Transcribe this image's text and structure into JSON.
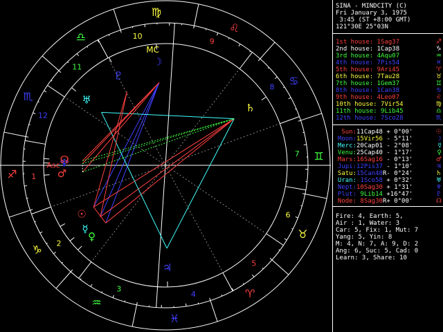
{
  "header": {
    "title": "SINA - MINDCITY (C)",
    "date": "Fri January 3, 1975",
    "time": " 3:45 (ST +8:00 GMT)",
    "location": "121°30E 25°03N"
  },
  "houses": [
    {
      "label": "1st house:",
      "value": " 1Sag37",
      "glyph": "♐",
      "color": "#ff4040"
    },
    {
      "label": "2nd house:",
      "value": " 1Cap38",
      "glyph": "♑",
      "color": "#ffffff"
    },
    {
      "label": "3rd house:",
      "value": " 4Aqu07",
      "glyph": "♒",
      "color": "#40ff40"
    },
    {
      "label": "4th house:",
      "value": " 7Pis54",
      "glyph": "♓",
      "color": "#4040ff"
    },
    {
      "label": "5th house:",
      "value": " 9Ari45",
      "glyph": "♈",
      "color": "#ff4040"
    },
    {
      "label": "6th house:",
      "value": " 7Tau28",
      "glyph": "♉",
      "color": "#ffff40"
    },
    {
      "label": "7th house:",
      "value": " 1Gem37",
      "glyph": "♊",
      "color": "#40ff40"
    },
    {
      "label": "8th house:",
      "value": " 1Can38",
      "glyph": "♋",
      "color": "#4040ff"
    },
    {
      "label": "9th house:",
      "value": " 4Leo07",
      "glyph": "♌",
      "color": "#ff4040"
    },
    {
      "label": "10th house:",
      "value": " 7Vir54",
      "glyph": "♍",
      "color": "#ffff40"
    },
    {
      "label": "11th house:",
      "value": " 9Lib45",
      "glyph": "♎",
      "color": "#40ff40"
    },
    {
      "label": "12th house:",
      "value": " 7Sco28",
      "glyph": "♏",
      "color": "#4040ff"
    }
  ],
  "planets": [
    {
      "name": "Sun:",
      "pos": "11Cap48",
      "r": " ",
      "lat": "+ 0°00'",
      "glyph": "☉",
      "color": "#ff4040",
      "poscolor": "#ffffff"
    },
    {
      "name": "Moon:",
      "pos": "15Vir56",
      "r": " ",
      "lat": "- 5°11'",
      "glyph": "☽",
      "color": "#4040ff",
      "poscolor": "#ffff40"
    },
    {
      "name": "Merc:",
      "pos": "20Cap01",
      "r": " ",
      "lat": "- 2°08'",
      "glyph": "☿",
      "color": "#40ffff",
      "poscolor": "#ffffff"
    },
    {
      "name": "Venu:",
      "pos": "25Cap40",
      "r": " ",
      "lat": "- 1°17'",
      "glyph": "♀",
      "color": "#40ff40",
      "poscolor": "#ffffff"
    },
    {
      "name": "Mars:",
      "pos": "16Sag16",
      "r": " ",
      "lat": "- 0°13'",
      "glyph": "♂",
      "color": "#ff4040",
      "poscolor": "#ff4040"
    },
    {
      "name": "Jupi:",
      "pos": "12Pis37",
      "r": " ",
      "lat": "- 1°10'",
      "glyph": "♃",
      "color": "#4040ff",
      "poscolor": "#4040ff"
    },
    {
      "name": "Satu:",
      "pos": "15Can48",
      "r": "R",
      "lat": "- 0°24'",
      "glyph": "♄",
      "color": "#ffff40",
      "poscolor": "#4040ff"
    },
    {
      "name": "Uran:",
      "pos": " 1Sco58",
      "r": " ",
      "lat": "+ 0°32'",
      "glyph": "♅",
      "color": "#40ffff",
      "poscolor": "#4040ff"
    },
    {
      "name": "Nept:",
      "pos": "10Sag30",
      "r": " ",
      "lat": "+ 1°31'",
      "glyph": "♆",
      "color": "#4040ff",
      "poscolor": "#ff4040"
    },
    {
      "name": "Plut:",
      "pos": " 9Lib14",
      "r": " ",
      "lat": "+16°47'",
      "glyph": "♇",
      "color": "#4040ff",
      "poscolor": "#40ff40"
    },
    {
      "name": "Node:",
      "pos": " 8Sag30",
      "r": "R",
      "lat": "+ 0°00'",
      "glyph": "☊",
      "color": "#ff4040",
      "poscolor": "#ff4040"
    }
  ],
  "stats": [
    "Fire: 4, Earth: 5,",
    "Air : 1, Water: 3",
    "Car: 5, Fix: 1, Mut: 7",
    "Yang: 5, Yin: 8",
    "M: 4, N: 7, A: 9, D: 2",
    "Ang: 6, Suc: 5, Cad: 0",
    "Learn: 3, Share: 10"
  ],
  "wheel": {
    "signs": [
      {
        "glyph": "♐",
        "color": "#ff4040"
      },
      {
        "glyph": "♑",
        "color": "#ffff40"
      },
      {
        "glyph": "♒",
        "color": "#40ff40"
      },
      {
        "glyph": "♓",
        "color": "#4040ff"
      },
      {
        "glyph": "♈",
        "color": "#ff4040"
      },
      {
        "glyph": "♉",
        "color": "#ffff40"
      },
      {
        "glyph": "♊",
        "color": "#40ff40"
      },
      {
        "glyph": "♋",
        "color": "#4040ff"
      },
      {
        "glyph": "♌",
        "color": "#ff4040"
      },
      {
        "glyph": "♍",
        "color": "#ffff40"
      },
      {
        "glyph": "♎",
        "color": "#40ff40"
      },
      {
        "glyph": "♏",
        "color": "#4040ff"
      }
    ],
    "house_numbers": [
      "1",
      "2",
      "3",
      "4",
      "5",
      "6",
      "7",
      "8",
      "9",
      "10",
      "11",
      "12"
    ],
    "house_number_colors": [
      "#ff4040",
      "#ffff40",
      "#40ff40",
      "#4040ff",
      "#ff4040",
      "#ffff40",
      "#40ff40",
      "#4040ff",
      "#ff4040",
      "#ffff40",
      "#40ff40",
      "#4040ff"
    ],
    "asc_label": "Asc",
    "mc_label": "MC",
    "asc_color": "#ff4040",
    "mc_color": "#ffff40",
    "planet_points": [
      {
        "glyph": "☉",
        "color": "#ff4040",
        "lon": 281.8
      },
      {
        "glyph": "☽",
        "color": "#4040ff",
        "lon": 165.93
      },
      {
        "glyph": "☿",
        "color": "#40ffff",
        "lon": 290.02
      },
      {
        "glyph": "♀",
        "color": "#40ff40",
        "lon": 295.67
      },
      {
        "glyph": "♂",
        "color": "#ff4040",
        "lon": 256.27
      },
      {
        "glyph": "♃",
        "color": "#4040ff",
        "lon": 342.62
      },
      {
        "glyph": "♄",
        "color": "#ffff40",
        "lon": 105.8
      },
      {
        "glyph": "♅",
        "color": "#40ffff",
        "lon": 211.97
      },
      {
        "glyph": "♆",
        "color": "#4040ff",
        "lon": 250.5
      },
      {
        "glyph": "♇",
        "color": "#4040ff",
        "lon": 189.23
      },
      {
        "glyph": "☊",
        "color": "#ff4040",
        "lon": 248.5
      }
    ],
    "aspects": [
      {
        "a": 0,
        "b": 1,
        "color": "#4040ff"
      },
      {
        "a": 2,
        "b": 1,
        "color": "#4040ff"
      },
      {
        "a": 3,
        "b": 1,
        "color": "#4040ff"
      },
      {
        "a": 0,
        "b": 6,
        "color": "#ff4040"
      },
      {
        "a": 2,
        "b": 6,
        "color": "#ff4040"
      },
      {
        "a": 3,
        "b": 6,
        "color": "#ff4040"
      },
      {
        "a": 6,
        "b": 7,
        "color": "#40ffff"
      },
      {
        "a": 7,
        "b": 5,
        "color": "#40ffff"
      },
      {
        "a": 6,
        "b": 5,
        "color": "#40ffff"
      },
      {
        "a": 4,
        "b": 1,
        "color": "#ff4040"
      },
      {
        "a": 8,
        "b": 1,
        "color": "#ff4040"
      },
      {
        "a": 10,
        "b": 1,
        "color": "#ff4040"
      },
      {
        "a": 4,
        "b": 6,
        "color": "#40ff40"
      },
      {
        "a": 8,
        "b": 6,
        "color": "#40ff40"
      },
      {
        "a": 10,
        "b": 6,
        "color": "#40ff40"
      },
      {
        "a": 9,
        "b": 0,
        "color": "#ff4040"
      },
      {
        "a": 9,
        "b": 2,
        "color": "#ff4040"
      },
      {
        "a": 4,
        "b": 8,
        "color": "#ffffff"
      },
      {
        "a": 0,
        "b": 3,
        "color": "#ff4040"
      }
    ]
  }
}
